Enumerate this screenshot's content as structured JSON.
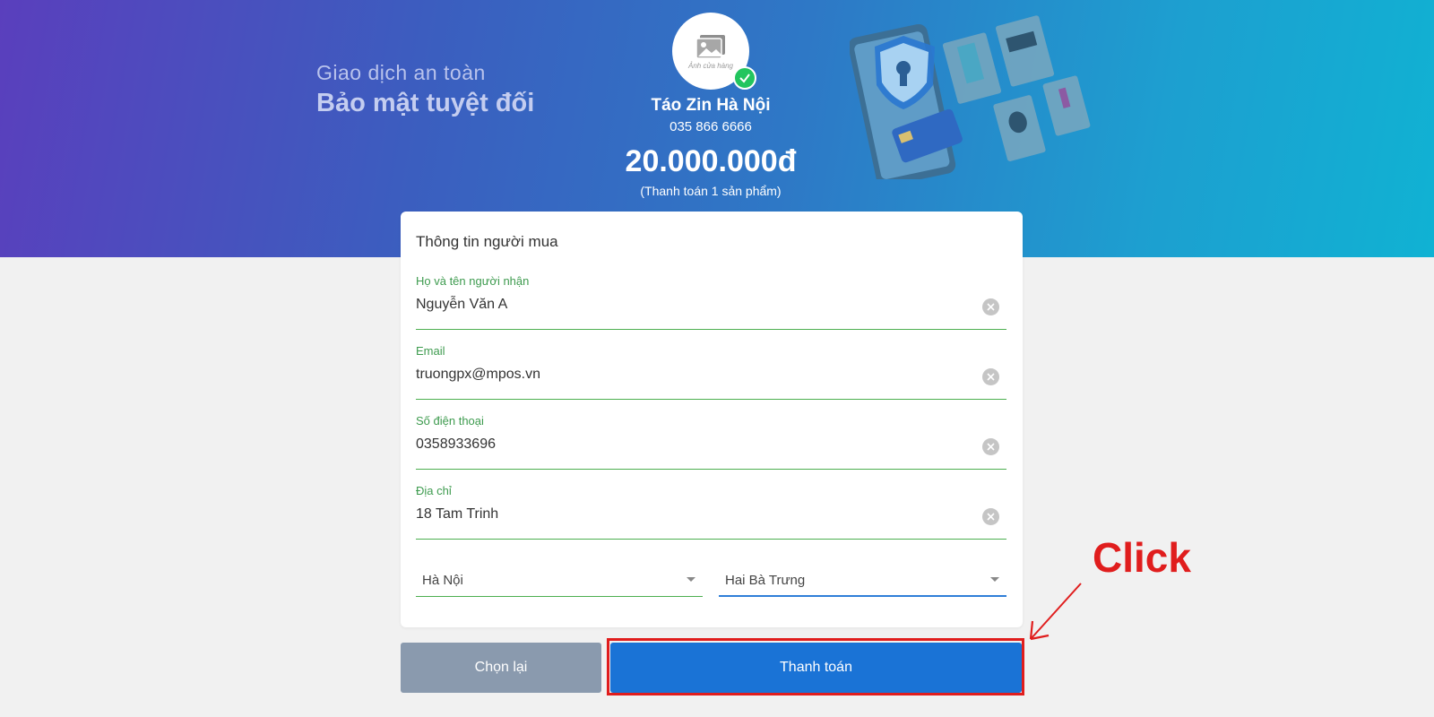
{
  "hero": {
    "tagline_1": "Giao dịch an toàn",
    "tagline_2": "Bảo mật tuyệt đối",
    "avatar_caption": "Ảnh cửa hàng",
    "shop_name": "Táo Zin Hà Nội",
    "shop_phone": "035 866 6666",
    "amount": "20.000.000đ",
    "amount_note": "(Thanh toán 1 sản phẩm)"
  },
  "form": {
    "title": "Thông tin người mua",
    "fields": [
      {
        "label": "Họ và tên người nhận",
        "value": "Nguyễn Văn A"
      },
      {
        "label": "Email",
        "value": "truongpx@mpos.vn"
      },
      {
        "label": "Số điện thoại",
        "value": "0358933696"
      },
      {
        "label": "Địa chỉ",
        "value": "18 Tam Trinh"
      }
    ],
    "city": "Hà Nội",
    "district": "Hai Bà Trưng"
  },
  "buttons": {
    "reset": "Chọn lại",
    "pay": "Thanh toán"
  },
  "annotation": {
    "label": "Click"
  },
  "colors": {
    "accent": "#1a73d6",
    "field_green": "#4caf50",
    "annotation_red": "#e01d1d"
  }
}
